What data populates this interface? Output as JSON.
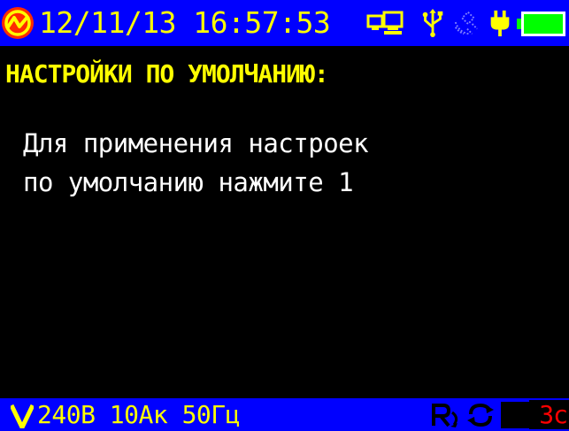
{
  "status_bar": {
    "datetime": "12/11/13 16:57:53",
    "icons": [
      "brand-logo-icon",
      "network-icon",
      "usb-icon",
      "gps-icon",
      "power-plug-icon",
      "battery-icon"
    ],
    "battery_level": 1.0,
    "colors": {
      "background": "#0000ff",
      "text": "#ffff00",
      "battery": "#00ff00",
      "logo": "#ff2a00"
    }
  },
  "title": "НАСТРОЙКИ ПО УМОЛЧАНИЮ:",
  "message": {
    "line1": "Для применения настроек",
    "line2": "по умолчанию нажмите 1"
  },
  "bottom_bar": {
    "mode_icon": "voltage-v-icon",
    "measurements": "240В 10Ак 50Гц",
    "icons": [
      "phase-rotation-icon",
      "refresh-icon"
    ],
    "timer": "3c",
    "colors": {
      "timer": "#ff0000"
    }
  }
}
